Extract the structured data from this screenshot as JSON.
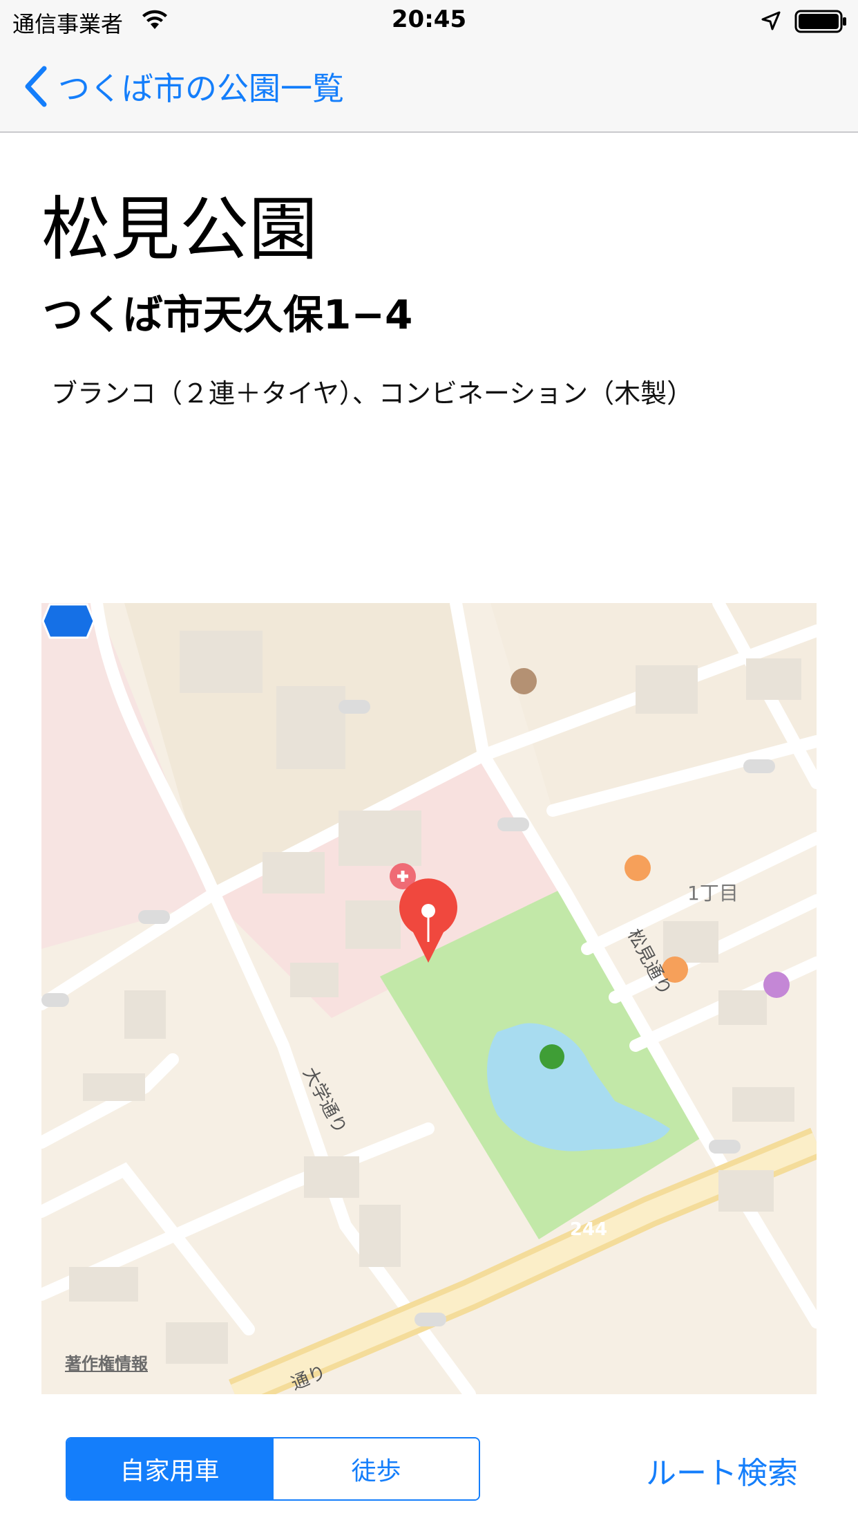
{
  "status_bar": {
    "carrier": "通信事業者",
    "time": "20:45"
  },
  "nav": {
    "back_label": "つくば市の公園一覧"
  },
  "park": {
    "name": "松見公園",
    "address": "つくば市天久保1−4",
    "equipment": "ブランコ（２連＋タイヤ）、コンビネーション（木製）"
  },
  "map": {
    "copyright": "著作権情報",
    "area_label": "1丁目",
    "roads": {
      "matsumi": "松見通り",
      "daigaku": "大学通り",
      "bottom": "通り"
    },
    "route_number": "244",
    "colors": {
      "park": "#c2e8a8",
      "water": "#a8dcf0",
      "pin": "#f0483e",
      "accent": "#147efb"
    }
  },
  "controls": {
    "transport_modes": [
      "自家用車",
      "徒歩"
    ],
    "selected_mode": "自家用車",
    "route_search": "ルート検索"
  }
}
